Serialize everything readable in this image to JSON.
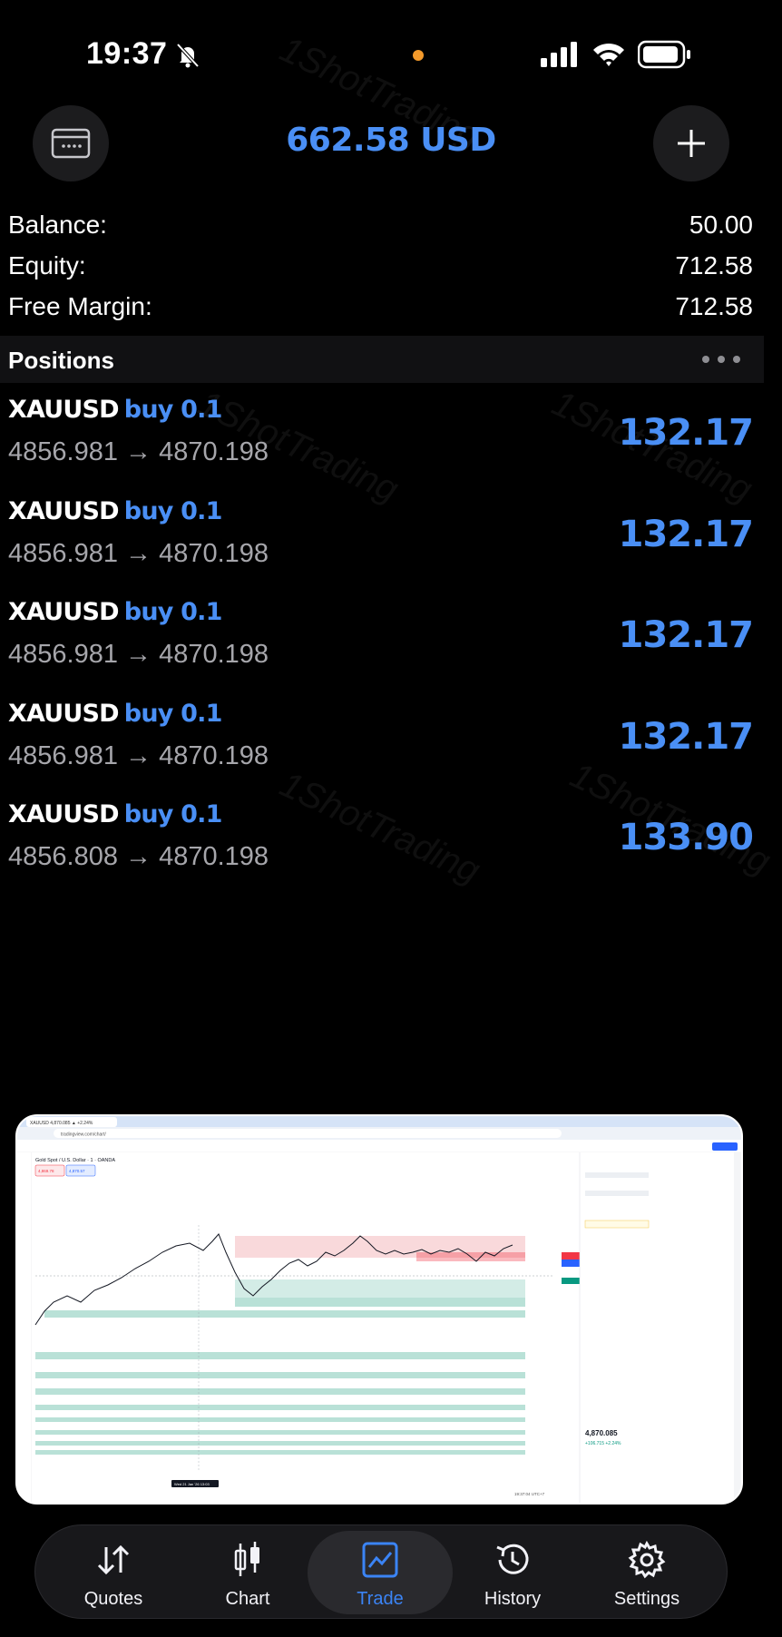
{
  "status_bar": {
    "time": "19:37"
  },
  "header": {
    "title": "662.58 USD",
    "colors": {
      "accent": "#4a8ff5"
    }
  },
  "summary": [
    {
      "label": "Balance:",
      "value": "50.00"
    },
    {
      "label": "Equity:",
      "value": "712.58"
    },
    {
      "label": "Free Margin:",
      "value": "712.58"
    }
  ],
  "positions": {
    "title": "Positions",
    "items": [
      {
        "symbol": "XAUUSD",
        "side": "buy 0.1",
        "open": "4856.981",
        "arrow": "→",
        "current": "4870.198",
        "profit": "132.17"
      },
      {
        "symbol": "XAUUSD",
        "side": "buy 0.1",
        "open": "4856.981",
        "arrow": "→",
        "current": "4870.198",
        "profit": "132.17"
      },
      {
        "symbol": "XAUUSD",
        "side": "buy 0.1",
        "open": "4856.981",
        "arrow": "→",
        "current": "4870.198",
        "profit": "132.17"
      },
      {
        "symbol": "XAUUSD",
        "side": "buy 0.1",
        "open": "4856.981",
        "arrow": "→",
        "current": "4870.198",
        "profit": "132.17"
      },
      {
        "symbol": "XAUUSD",
        "side": "buy 0.1",
        "open": "4856.808",
        "arrow": "→",
        "current": "4870.198",
        "profit": "133.90"
      }
    ]
  },
  "watermark": "1ShotTrading",
  "preview": {
    "tab_title": "XAUUSD 4,870.085 ▲ +2.24%",
    "url": "tradingview.com/chart/",
    "chart_title": "Gold Spot / U.S. Dollar · 1 · OANDA",
    "sell_price": "4,869.78",
    "buy_price": "4,870.57",
    "last_price": "4,870.085",
    "last_change": "+106.715 +2.24%",
    "date_label": "Wed 21 Jan '26 13:03",
    "time_readout": "19:37:04 UTC+7"
  },
  "nav": {
    "items": [
      {
        "label": "Quotes",
        "icon": "arrows-up-down-icon"
      },
      {
        "label": "Chart",
        "icon": "candlestick-icon"
      },
      {
        "label": "Trade",
        "icon": "trade-chart-icon",
        "active": true
      },
      {
        "label": "History",
        "icon": "history-clock-icon"
      },
      {
        "label": "Settings",
        "icon": "gear-icon"
      }
    ],
    "active_color": "#3b84f5"
  }
}
